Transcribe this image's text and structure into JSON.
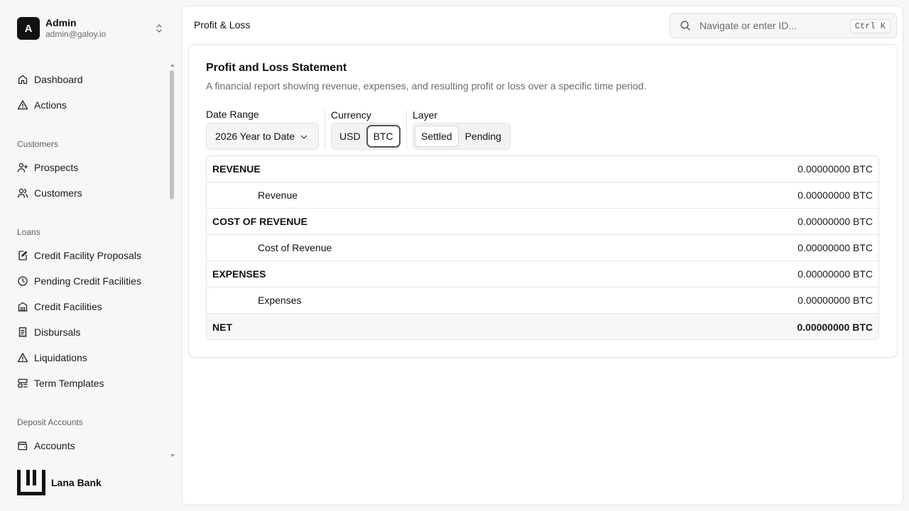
{
  "user": {
    "initial": "A",
    "name": "Admin",
    "email": "admin@galoy.io"
  },
  "nav": {
    "top": [
      {
        "label": "Dashboard",
        "icon": "home-icon"
      },
      {
        "label": "Actions",
        "icon": "alert-triangle-icon"
      }
    ],
    "groups": [
      {
        "title": "Customers",
        "items": [
          {
            "label": "Prospects",
            "icon": "user-plus-icon"
          },
          {
            "label": "Customers",
            "icon": "users-icon"
          }
        ]
      },
      {
        "title": "Loans",
        "items": [
          {
            "label": "Credit Facility Proposals",
            "icon": "file-edit-icon"
          },
          {
            "label": "Pending Credit Facilities",
            "icon": "clock-icon"
          },
          {
            "label": "Credit Facilities",
            "icon": "building-icon"
          },
          {
            "label": "Disbursals",
            "icon": "receipt-icon"
          },
          {
            "label": "Liquidations",
            "icon": "alert-triangle-icon"
          },
          {
            "label": "Term Templates",
            "icon": "template-icon"
          }
        ]
      },
      {
        "title": "Deposit Accounts",
        "items": [
          {
            "label": "Accounts",
            "icon": "wallet-icon"
          }
        ]
      }
    ]
  },
  "brand": {
    "name": "Lana Bank"
  },
  "header": {
    "breadcrumb": "Profit & Loss",
    "search_placeholder": "Navigate or enter ID...",
    "shortcut": "Ctrl K"
  },
  "report": {
    "title": "Profit and Loss Statement",
    "description": "A financial report showing revenue, expenses, and resulting profit or loss over a specific time period.",
    "date_range_label": "Date Range",
    "date_range_value": "2026 Year to Date",
    "currency_label": "Currency",
    "currency_options": [
      "USD",
      "BTC"
    ],
    "currency_selected": "BTC",
    "layer_label": "Layer",
    "layer_options": [
      "Settled",
      "Pending"
    ],
    "layer_selected": "Settled",
    "rows": [
      {
        "name": "REVENUE",
        "amount": "0.00000000 BTC",
        "kind": "cat"
      },
      {
        "name": "Revenue",
        "amount": "0.00000000 BTC",
        "kind": "sub"
      },
      {
        "name": "COST OF REVENUE",
        "amount": "0.00000000 BTC",
        "kind": "cat"
      },
      {
        "name": "Cost of Revenue",
        "amount": "0.00000000 BTC",
        "kind": "sub"
      },
      {
        "name": "EXPENSES",
        "amount": "0.00000000 BTC",
        "kind": "cat"
      },
      {
        "name": "Expenses",
        "amount": "0.00000000 BTC",
        "kind": "sub"
      },
      {
        "name": "NET",
        "amount": "0.00000000 BTC",
        "kind": "net"
      }
    ]
  }
}
